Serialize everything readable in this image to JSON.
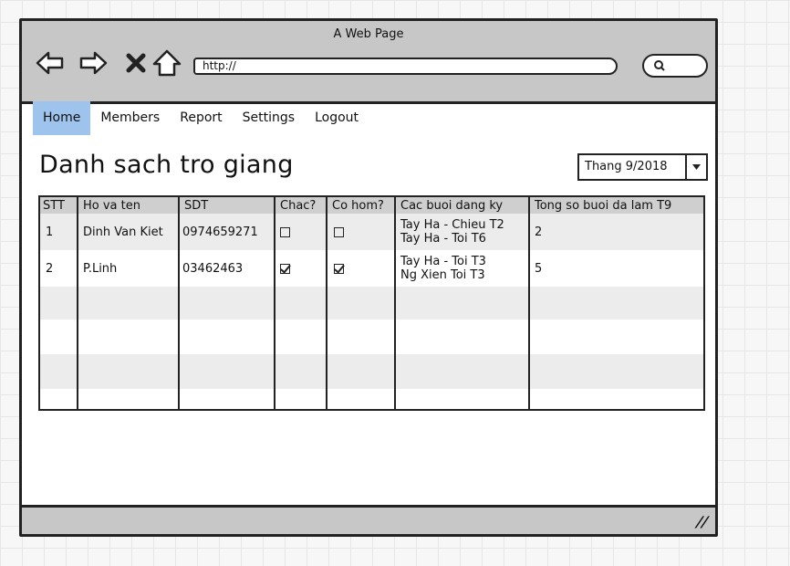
{
  "window": {
    "title": "A Web Page"
  },
  "browser": {
    "url": "http://"
  },
  "menu": [
    {
      "label": "Home",
      "active": true
    },
    {
      "label": "Members",
      "active": false
    },
    {
      "label": "Report",
      "active": false
    },
    {
      "label": "Settings",
      "active": false
    },
    {
      "label": "Logout",
      "active": false
    }
  ],
  "page": {
    "title": "Danh sach tro giang"
  },
  "month_select": {
    "value": "Thang 9/2018"
  },
  "table": {
    "headers": [
      "STT",
      "Ho va ten",
      "SDT",
      "Chac?",
      "Co hom?",
      "Cac buoi dang ky",
      "Tong so buoi da lam T9"
    ],
    "rows": [
      {
        "stt": "1",
        "name": "Dinh Van Kiet",
        "sdt": "0974659271",
        "chac": false,
        "cohom": false,
        "buoi1": "Tay Ha - Chieu T2",
        "buoi2": "Tay Ha - Toi T6",
        "tong": "2"
      },
      {
        "stt": "2",
        "name": "P.Linh",
        "sdt": "03462463",
        "chac": true,
        "cohom": true,
        "buoi1": "Tay Ha - Toi T3",
        "buoi2": "Ng Xien Toi T3",
        "tong": "5"
      }
    ]
  },
  "icons": {
    "back": "back-arrow-icon",
    "forward": "forward-arrow-icon",
    "stop": "close-icon",
    "home": "home-icon",
    "search": "search-icon",
    "dropdown": "chevron-down-icon",
    "resize": "resize-grip-icon"
  }
}
